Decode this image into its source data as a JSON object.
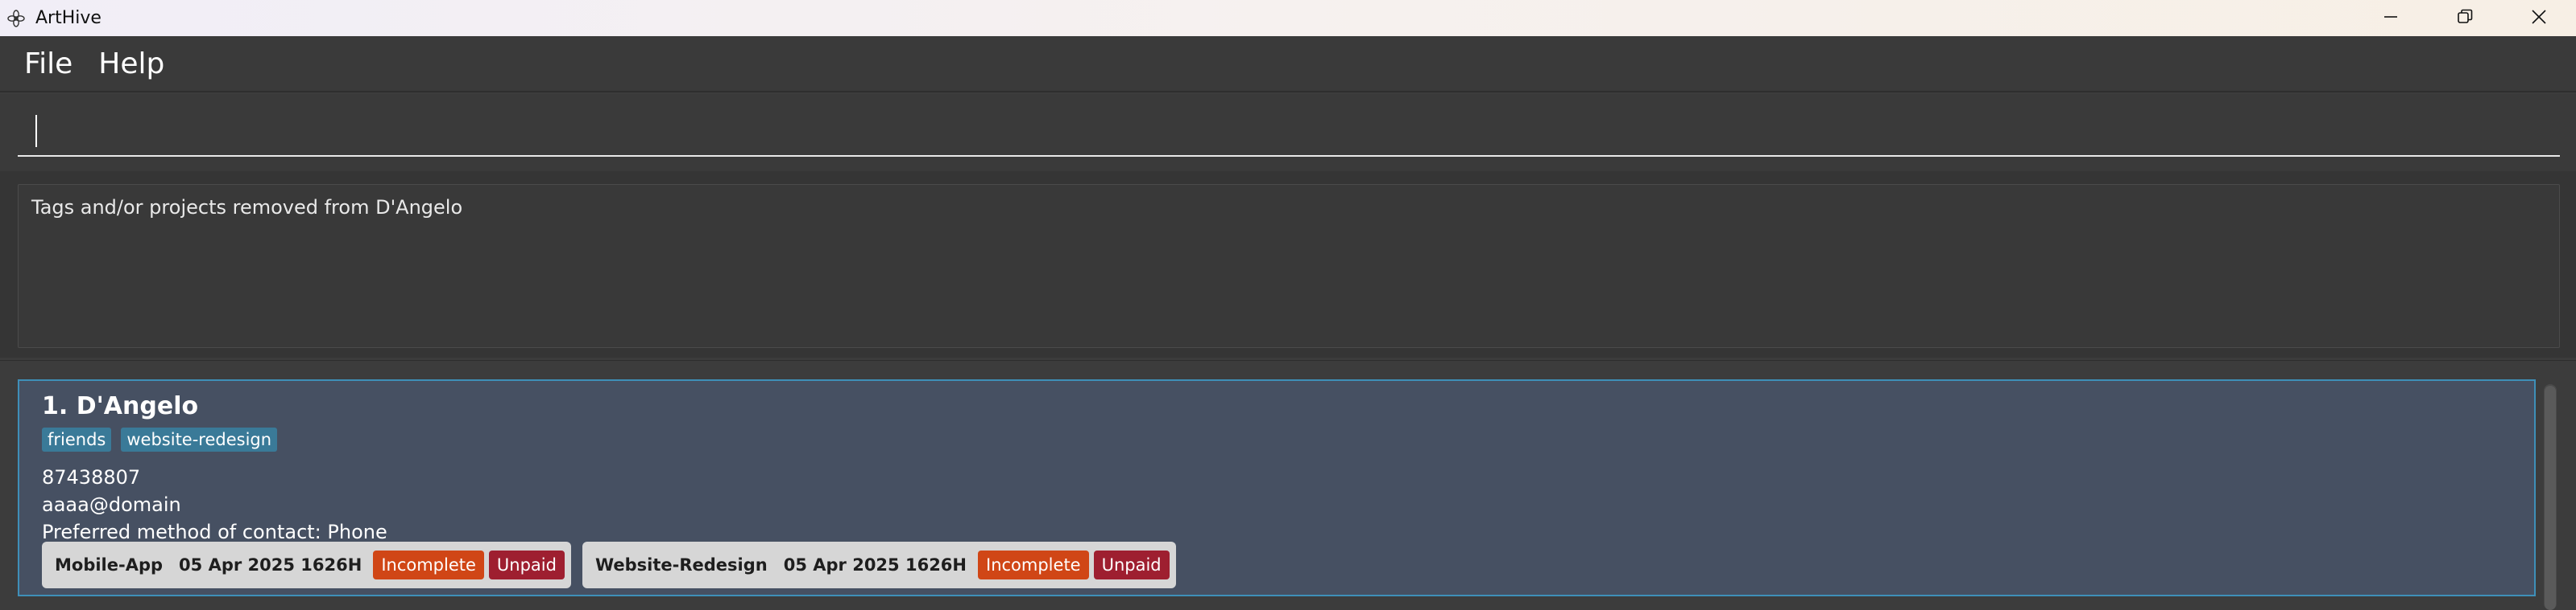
{
  "window": {
    "title": "ArtHive",
    "icon": "flower-icon",
    "controls": [
      "minimize-icon",
      "maximize-icon",
      "close-icon"
    ]
  },
  "menu": {
    "file_label": "File",
    "help_label": "Help"
  },
  "command": {
    "value": ""
  },
  "result": {
    "message": "Tags and/or projects removed from D'Angelo"
  },
  "person_list": [
    {
      "index_name": "1. D'Angelo",
      "tags": [
        "friends",
        "website-redesign"
      ],
      "phone": "87438807",
      "email": "aaaa@domain",
      "preferred_contact": "Preferred method of contact: Phone",
      "projects": [
        {
          "name": "Mobile-App",
          "deadline": "05 Apr 2025 1626H",
          "status": "Incomplete",
          "payment": "Unpaid"
        },
        {
          "name": "Website-Redesign",
          "deadline": "05 Apr 2025 1626H",
          "status": "Incomplete",
          "payment": "Unpaid"
        }
      ]
    }
  ],
  "colors": {
    "card_background": "#465062",
    "card_border": "#3e8fb8",
    "tag": "#3a7a98",
    "incomplete": "#d04616",
    "unpaid": "#9e1f30"
  }
}
